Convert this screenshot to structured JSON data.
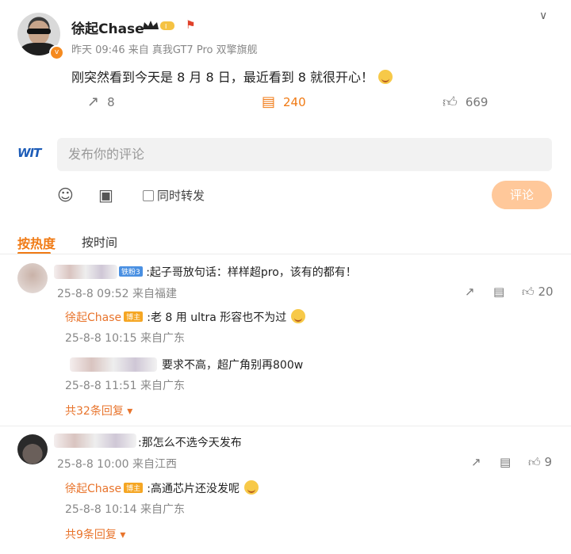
{
  "post": {
    "author": "徐起Chase",
    "time": "昨天 09:46",
    "source": "来自 真我GT7 Pro 双擎旗舰",
    "text": "刚突然看到今天是 8 月 8 日，最近看到 8 就很开心！",
    "reposts": "8",
    "comments": "240",
    "likes": "669"
  },
  "composer": {
    "logo": "WIT",
    "placeholder": "发布你的评论",
    "repost_label": "同时转发",
    "submit_label": "评论"
  },
  "sort": {
    "hot": "按热度",
    "time": "按时间"
  },
  "comments": [
    {
      "tag": "铁粉3",
      "text": ":起子哥放句话：样样超pro，该有的都有！",
      "meta": "25-8-8 09:52 来自福建",
      "likes": "20",
      "replies": [
        {
          "name": "徐起Chase",
          "tag": "博主",
          "text": ":老 8 用 ultra 形容也不为过",
          "meta": "25-8-8 10:15 来自广东"
        },
        {
          "name": "",
          "tag": "",
          "text": "要求不高，超广角别再800w",
          "meta": "25-8-8 11:51 来自广东"
        }
      ],
      "more": "共32条回复"
    },
    {
      "tag": "",
      "text": ":那怎么不选今天发布",
      "meta": "25-8-8 10:00 来自江西",
      "likes": "9",
      "replies": [
        {
          "name": "徐起Chase",
          "tag": "博主",
          "text": ":高通芯片还没发呢",
          "meta": "25-8-8 10:14 来自广东"
        }
      ],
      "more": "共9条回复"
    }
  ],
  "colors": {
    "accent": "#f07a14",
    "name": "#e8742c",
    "submit": "#ffc89a"
  }
}
